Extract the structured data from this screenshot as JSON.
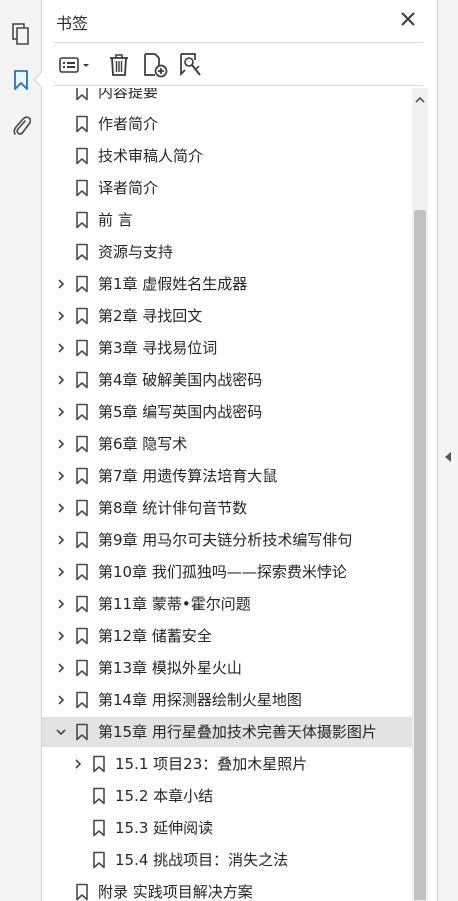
{
  "panel": {
    "title": "书签"
  },
  "bookmarks": [
    {
      "label": "内容提要",
      "depth": 0,
      "expander": "none",
      "selected": false
    },
    {
      "label": "作者简介",
      "depth": 0,
      "expander": "none",
      "selected": false
    },
    {
      "label": "技术审稿人简介",
      "depth": 0,
      "expander": "none",
      "selected": false
    },
    {
      "label": "译者简介",
      "depth": 0,
      "expander": "none",
      "selected": false
    },
    {
      "label": "前  言",
      "depth": 0,
      "expander": "none",
      "selected": false
    },
    {
      "label": "资源与支持",
      "depth": 0,
      "expander": "none",
      "selected": false
    },
    {
      "label": "第1章 虚假姓名生成器",
      "depth": 0,
      "expander": "collapsed",
      "selected": false
    },
    {
      "label": "第2章 寻找回文",
      "depth": 0,
      "expander": "collapsed",
      "selected": false
    },
    {
      "label": "第3章 寻找易位词",
      "depth": 0,
      "expander": "collapsed",
      "selected": false
    },
    {
      "label": "第4章 破解美国内战密码",
      "depth": 0,
      "expander": "collapsed",
      "selected": false
    },
    {
      "label": "第5章 编写英国内战密码",
      "depth": 0,
      "expander": "collapsed",
      "selected": false
    },
    {
      "label": "第6章 隐写术",
      "depth": 0,
      "expander": "collapsed",
      "selected": false
    },
    {
      "label": "第7章 用遗传算法培育大鼠",
      "depth": 0,
      "expander": "collapsed",
      "selected": false
    },
    {
      "label": "第8章 统计俳句音节数",
      "depth": 0,
      "expander": "collapsed",
      "selected": false
    },
    {
      "label": "第9章 用马尔可夫链分析技术编写俳句",
      "depth": 0,
      "expander": "collapsed",
      "selected": false
    },
    {
      "label": "第10章 我们孤独吗——探索费米悖论",
      "depth": 0,
      "expander": "collapsed",
      "selected": false
    },
    {
      "label": "第11章 蒙蒂•霍尔问题",
      "depth": 0,
      "expander": "collapsed",
      "selected": false
    },
    {
      "label": "第12章 储蓄安全",
      "depth": 0,
      "expander": "collapsed",
      "selected": false
    },
    {
      "label": "第13章 模拟外星火山",
      "depth": 0,
      "expander": "collapsed",
      "selected": false
    },
    {
      "label": "第14章 用探测器绘制火星地图",
      "depth": 0,
      "expander": "collapsed",
      "selected": false
    },
    {
      "label": "第15章 用行星叠加技术完善天体摄影图片",
      "depth": 0,
      "expander": "expanded",
      "selected": true
    },
    {
      "label": "15.1 项目23：叠加木星照片",
      "depth": 1,
      "expander": "collapsed",
      "selected": false
    },
    {
      "label": "15.2 本章小结",
      "depth": 1,
      "expander": "none",
      "selected": false
    },
    {
      "label": "15.3 延伸阅读",
      "depth": 1,
      "expander": "none",
      "selected": false
    },
    {
      "label": "15.4 挑战项目：消失之法",
      "depth": 1,
      "expander": "none",
      "selected": false
    },
    {
      "label": "附录 实践项目解决方案",
      "depth": 0,
      "expander": "none",
      "selected": false
    }
  ]
}
